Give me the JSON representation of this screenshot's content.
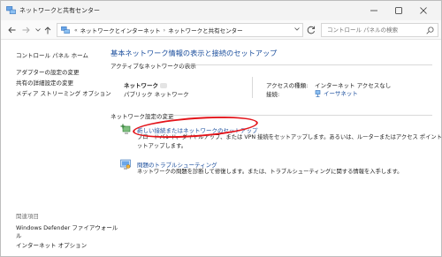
{
  "window": {
    "title": "ネットワークと共有センター",
    "icon": "network-app-icon"
  },
  "address_bar": {
    "overflow": "«",
    "crumbs": [
      "ネットワークとインターネット",
      "ネットワークと共有センター"
    ],
    "search_placeholder": "コントロール パネルの検索"
  },
  "sidebar": {
    "home": "コントロール パネル ホーム",
    "links": [
      "アダプターの設定の変更",
      "共有の詳細設定の変更",
      "メディア ストリーミング オプション"
    ],
    "related_heading": "関連項目",
    "related": [
      "Windows Defender ファイアウォール",
      "インターネット オプション"
    ]
  },
  "main": {
    "heading": "基本ネットワーク情報の表示と接続のセットアップ",
    "active_networks_label": "アクティブなネットワークの表示",
    "network": {
      "name": "ネットワーク",
      "type": "パブリック ネットワーク",
      "access_type_label": "アクセスの種類:",
      "access_type_value": "インターネット アクセスなし",
      "connection_label": "接続:",
      "connection_value": "イーサネット"
    },
    "change_settings_label": "ネットワーク設定の変更",
    "tasks": [
      {
        "title": "新しい接続またはネットワークのセットアップ",
        "desc_lines": [
          "ブロードバンド、ダイヤルアップ、または VPN 接続をセットアップします。あるいは、ルーターまたはアクセス ポイントをセ",
          "ットアップします。"
        ],
        "icon": "new-connection-icon"
      },
      {
        "title": "問題のトラブルシューティング",
        "desc_lines": [
          "ネットワークの問題を診断して修復します。または、トラブルシューティングに関する情報を入手します。"
        ],
        "icon": "troubleshoot-icon"
      }
    ]
  },
  "colors": {
    "link": "#1a4d9c",
    "annotation": "#e3141a"
  }
}
